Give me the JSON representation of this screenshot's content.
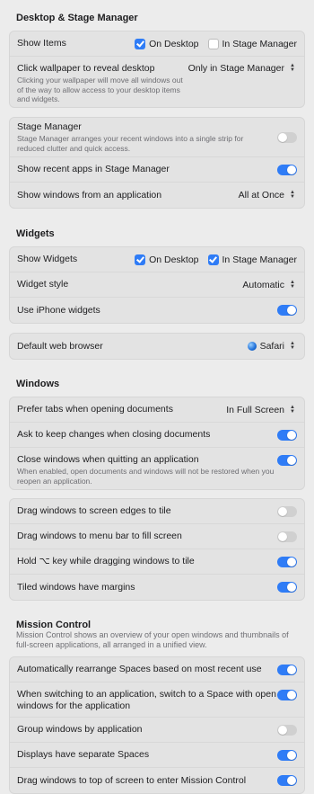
{
  "desktop_stage": {
    "title": "Desktop & Stage Manager",
    "show_items": {
      "label": "Show Items",
      "on_desktop": "On Desktop",
      "in_stage_manager": "In Stage Manager"
    },
    "click_wallpaper": {
      "label": "Click wallpaper to reveal desktop",
      "desc": "Clicking your wallpaper will move all windows out of the way to allow access to your desktop items and widgets.",
      "value": "Only in Stage Manager"
    },
    "stage_manager": {
      "label": "Stage Manager",
      "desc": "Stage Manager arranges your recent windows into a single strip for reduced clutter and quick access."
    },
    "show_recent_apps": {
      "label": "Show recent apps in Stage Manager"
    },
    "show_windows_from_app": {
      "label": "Show windows from an application",
      "value": "All at Once"
    }
  },
  "widgets": {
    "title": "Widgets",
    "show_widgets": {
      "label": "Show Widgets",
      "on_desktop": "On Desktop",
      "in_stage_manager": "In Stage Manager"
    },
    "widget_style": {
      "label": "Widget style",
      "value": "Automatic"
    },
    "use_iphone_widgets": {
      "label": "Use iPhone widgets"
    },
    "default_browser": {
      "label": "Default web browser",
      "value": "Safari"
    }
  },
  "windows": {
    "title": "Windows",
    "prefer_tabs": {
      "label": "Prefer tabs when opening documents",
      "value": "In Full Screen"
    },
    "ask_keep_changes": {
      "label": "Ask to keep changes when closing documents"
    },
    "close_windows": {
      "label": "Close windows when quitting an application",
      "desc": "When enabled, open documents and windows will not be restored when you reopen an application."
    },
    "drag_edges": {
      "label": "Drag windows to screen edges to tile"
    },
    "drag_menubar": {
      "label": "Drag windows to menu bar to fill screen"
    },
    "hold_option": {
      "label_pre": "Hold ",
      "key": "⌥",
      "label_post": " key while dragging windows to tile"
    },
    "tiled_margins": {
      "label": "Tiled windows have margins"
    }
  },
  "mission_control": {
    "title": "Mission Control",
    "desc": "Mission Control shows an overview of your open windows and thumbnails of full-screen applications, all arranged in a unified view.",
    "auto_rearrange": {
      "label": "Automatically rearrange Spaces based on most recent use"
    },
    "switch_space": {
      "label": "When switching to an application, switch to a Space with open windows for the application"
    },
    "group_windows": {
      "label": "Group windows by application"
    },
    "separate_spaces": {
      "label": "Displays have separate Spaces"
    },
    "drag_top": {
      "label": "Drag windows to top of screen to enter Mission Control"
    }
  },
  "colors": {
    "accent": "#2f7cf6",
    "toggle_off": "#d0d0d0",
    "group_bg": "#e3e3e3"
  }
}
